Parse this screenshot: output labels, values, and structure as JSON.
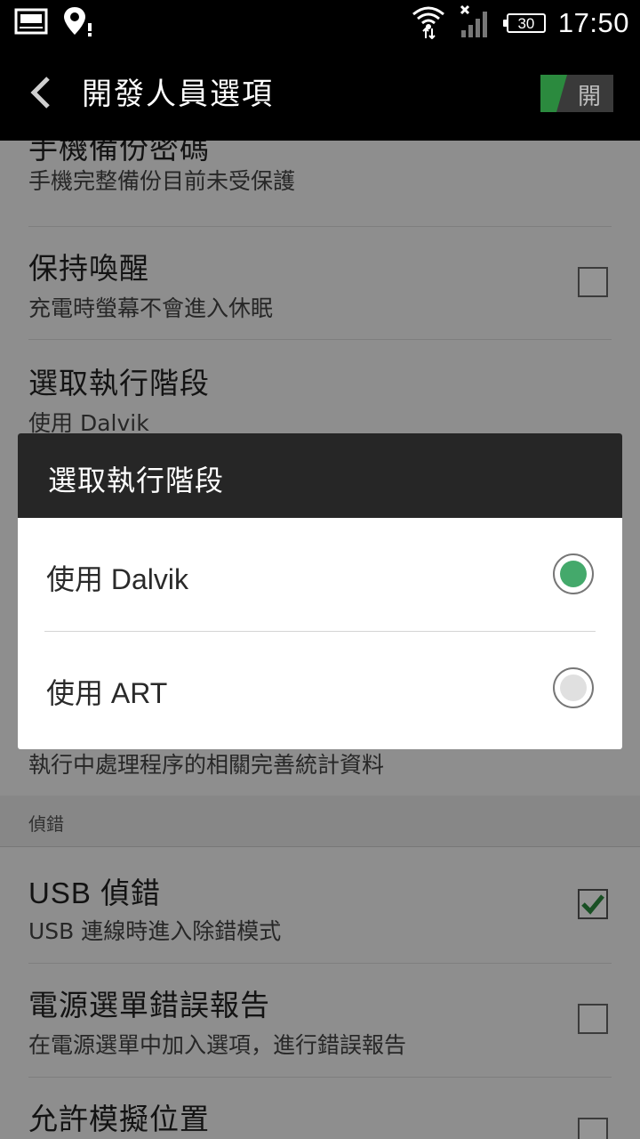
{
  "status_bar": {
    "time": "17:50",
    "battery": "30",
    "icons": [
      "gallery-icon",
      "location-alert-icon",
      "wifi-icon",
      "no-signal-icon",
      "battery-icon"
    ]
  },
  "action_bar": {
    "title": "開發人員選項",
    "toggle_label": "開",
    "accent": "#2b8a3e"
  },
  "settings": {
    "backup_password": {
      "title": "手機備份密碼",
      "subtitle": "手機完整備份目前未受保護"
    },
    "stay_awake": {
      "title": "保持喚醒",
      "subtitle": "充電時螢幕不會進入休眠",
      "checked": false
    },
    "select_runtime": {
      "title": "選取執行階段",
      "subtitle": "使用 Dalvik"
    },
    "process_stats_subtitle": "執行中處理程序的相關完善統計資料",
    "debug_section": "偵錯",
    "usb_debugging": {
      "title": "USB 偵錯",
      "subtitle": "USB 連線時進入除錯模式",
      "checked": true
    },
    "power_menu_bug": {
      "title": "電源選單錯誤報告",
      "subtitle": "在電源選單中加入選項，進行錯誤報告",
      "checked": false
    },
    "mock_locations": {
      "title": "允許模擬位置",
      "checked": false
    }
  },
  "dialog": {
    "title": "選取執行階段",
    "options": [
      {
        "label": "使用 Dalvik",
        "selected": true
      },
      {
        "label": "使用 ART",
        "selected": false
      }
    ],
    "selected_color": "#44a96b",
    "unselected_color": "#e0e0e0"
  }
}
